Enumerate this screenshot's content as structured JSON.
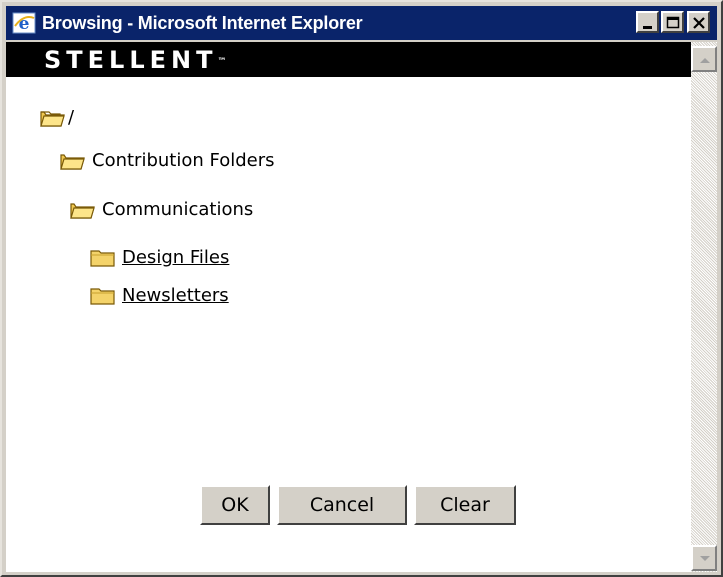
{
  "window": {
    "title": "Browsing - Microsoft Internet Explorer",
    "title_icon": "ie-icon",
    "controls": [
      "minimize-icon",
      "maximize-icon",
      "close-icon"
    ]
  },
  "brand": {
    "logo_text": "STELLENT",
    "trademark": "™"
  },
  "tree": {
    "root": "/",
    "items": [
      {
        "label": "Contribution Folders",
        "link": false
      },
      {
        "label": "Communications",
        "link": false
      },
      {
        "label": "Design Files",
        "link": true
      },
      {
        "label": "Newsletters",
        "link": true
      }
    ]
  },
  "buttons": {
    "ok": "OK",
    "cancel": "Cancel",
    "clear": "Clear"
  },
  "colors": {
    "titlebar": "#0a246a",
    "brandbar": "#000000",
    "folder": "#f4d36a",
    "chrome": "#d4d0c8"
  }
}
